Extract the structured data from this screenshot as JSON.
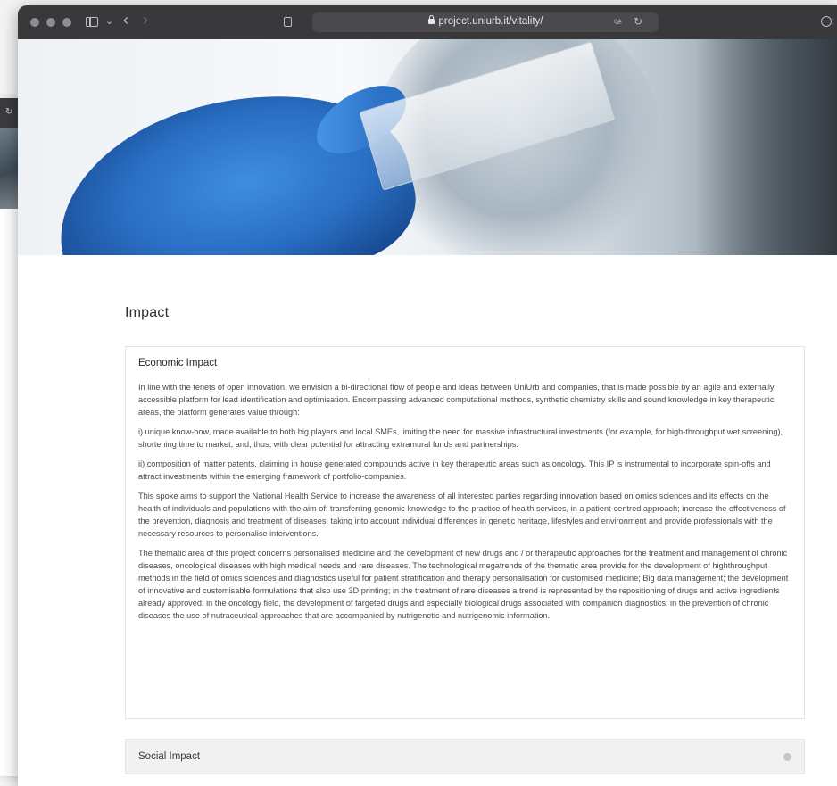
{
  "browser": {
    "url": "project.uniurb.it/vitality/",
    "icons": {
      "sidebar": "sidebar-icon",
      "back": "chevron-left-icon",
      "forward": "chevron-right-icon",
      "reader": "reader-icon",
      "lock": "lock-icon",
      "translate": "translate-icon",
      "reload": "reload-icon",
      "download": "download-icon"
    },
    "glyphs": {
      "chevron_down": "⌄",
      "back": "‹",
      "forward": "›",
      "translate": "ᴳ̶ᴬ",
      "reload": "↻"
    }
  },
  "page": {
    "title": "Impact",
    "economic": {
      "heading": "Economic Impact",
      "paragraphs": [
        "In line with the tenets of open innovation, we envision a bi-directional flow of people and ideas between UniUrb and companies, that is made possible by an agile and externally accessible platform for lead identification and optimisation. Encompassing advanced computational methods, synthetic chemistry skills and sound knowledge in key therapeutic areas, the platform generates value through:",
        "i) unique know-how, made available to both big players and local SMEs, limiting the need for massive infrastructural investments (for example, for high-throughput wet screening), shortening time to market, and, thus, with clear potential for attracting extramural funds and partnerships.",
        "ii) composition of matter patents, claiming in house generated compounds active in key therapeutic areas such as oncology. This IP is instrumental to incorporate spin-offs and attract investments within the emerging framework of portfolio-companies.",
        "This spoke aims to support the National Health Service to increase the awareness of all interested parties regarding innovation based on omics sciences and its effects on the health of individuals and populations with the aim of: transferring genomic knowledge to the practice of health services, in a patient-centred approach; increase the effectiveness of the prevention, diagnosis and treatment of diseases, taking into account individual differences in genetic heritage, lifestyles and environment and provide professionals with the necessary resources to personalise interventions.",
        "The thematic area of this project concerns personalised medicine and the development of new drugs and / or therapeutic approaches for the treatment and management of chronic diseases, oncological diseases with high medical needs and rare diseases. The technological megatrends of the thematic area provide for the development of highthroughput methods in the field of omics sciences and diagnostics useful for patient stratification and therapy personalisation for customised medicine; Big data management; the development of innovative and customisable formulations that also use 3D printing; in the treatment of rare diseases a trend is represented by the repositioning of drugs and active ingredients already approved; in the oncology field, the development of targeted drugs and especially biological drugs associated with companion diagnostics; in the prevention of chronic diseases the use of nutraceutical approaches that are accompanied by nutrigenetic and nutrigenomic information."
      ]
    },
    "social": {
      "heading": "Social Impact",
      "expanded": false
    }
  },
  "colors": {
    "toolbar": "#39393b",
    "accent_glove": "#2a6fc4",
    "panel_border": "#e4e4e4"
  }
}
